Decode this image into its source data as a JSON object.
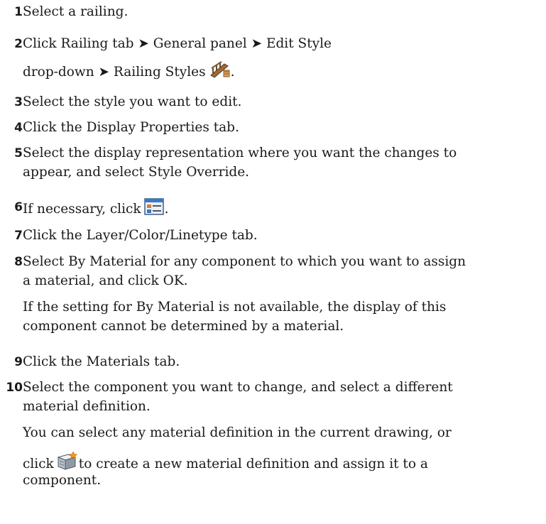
{
  "steps": [
    {
      "num": "1",
      "text": "Select a railing."
    },
    {
      "num": "2",
      "text": "Click Railing tab ➤ General panel ➤ Edit Style",
      "text2_a": "drop-down ➤ Railing Styles",
      "text2_b": "."
    },
    {
      "num": "3",
      "text": "Select the style you want to edit."
    },
    {
      "num": "4",
      "text": "Click the Display Properties tab."
    },
    {
      "num": "5",
      "text": "Select the display representation where you want the changes to",
      "text2": "appear, and select Style Override."
    },
    {
      "num": "6",
      "text_a": "If necessary, click",
      "text_b": "."
    },
    {
      "num": "7",
      "text": "Click the Layer/Color/Linetype tab."
    },
    {
      "num": "8",
      "text": "Select By Material for any component to which you want to assign",
      "text2": "a material, and click OK.",
      "note1": "If the setting for By Material is not available, the display of this",
      "note2": "component cannot be determined by a material."
    },
    {
      "num": "9",
      "text": "Click the Materials tab."
    },
    {
      "num": "10",
      "text": "Select the component you want to change, and select a different",
      "text2": "material definition.",
      "note1": "You can select any material definition in the current drawing, or",
      "note2_a": "click",
      "note2_b": "to create a new material definition and assign it to a",
      "note3": "component."
    }
  ],
  "icons": [
    "railing-styles-icon",
    "display-properties-icon",
    "new-material-icon"
  ]
}
